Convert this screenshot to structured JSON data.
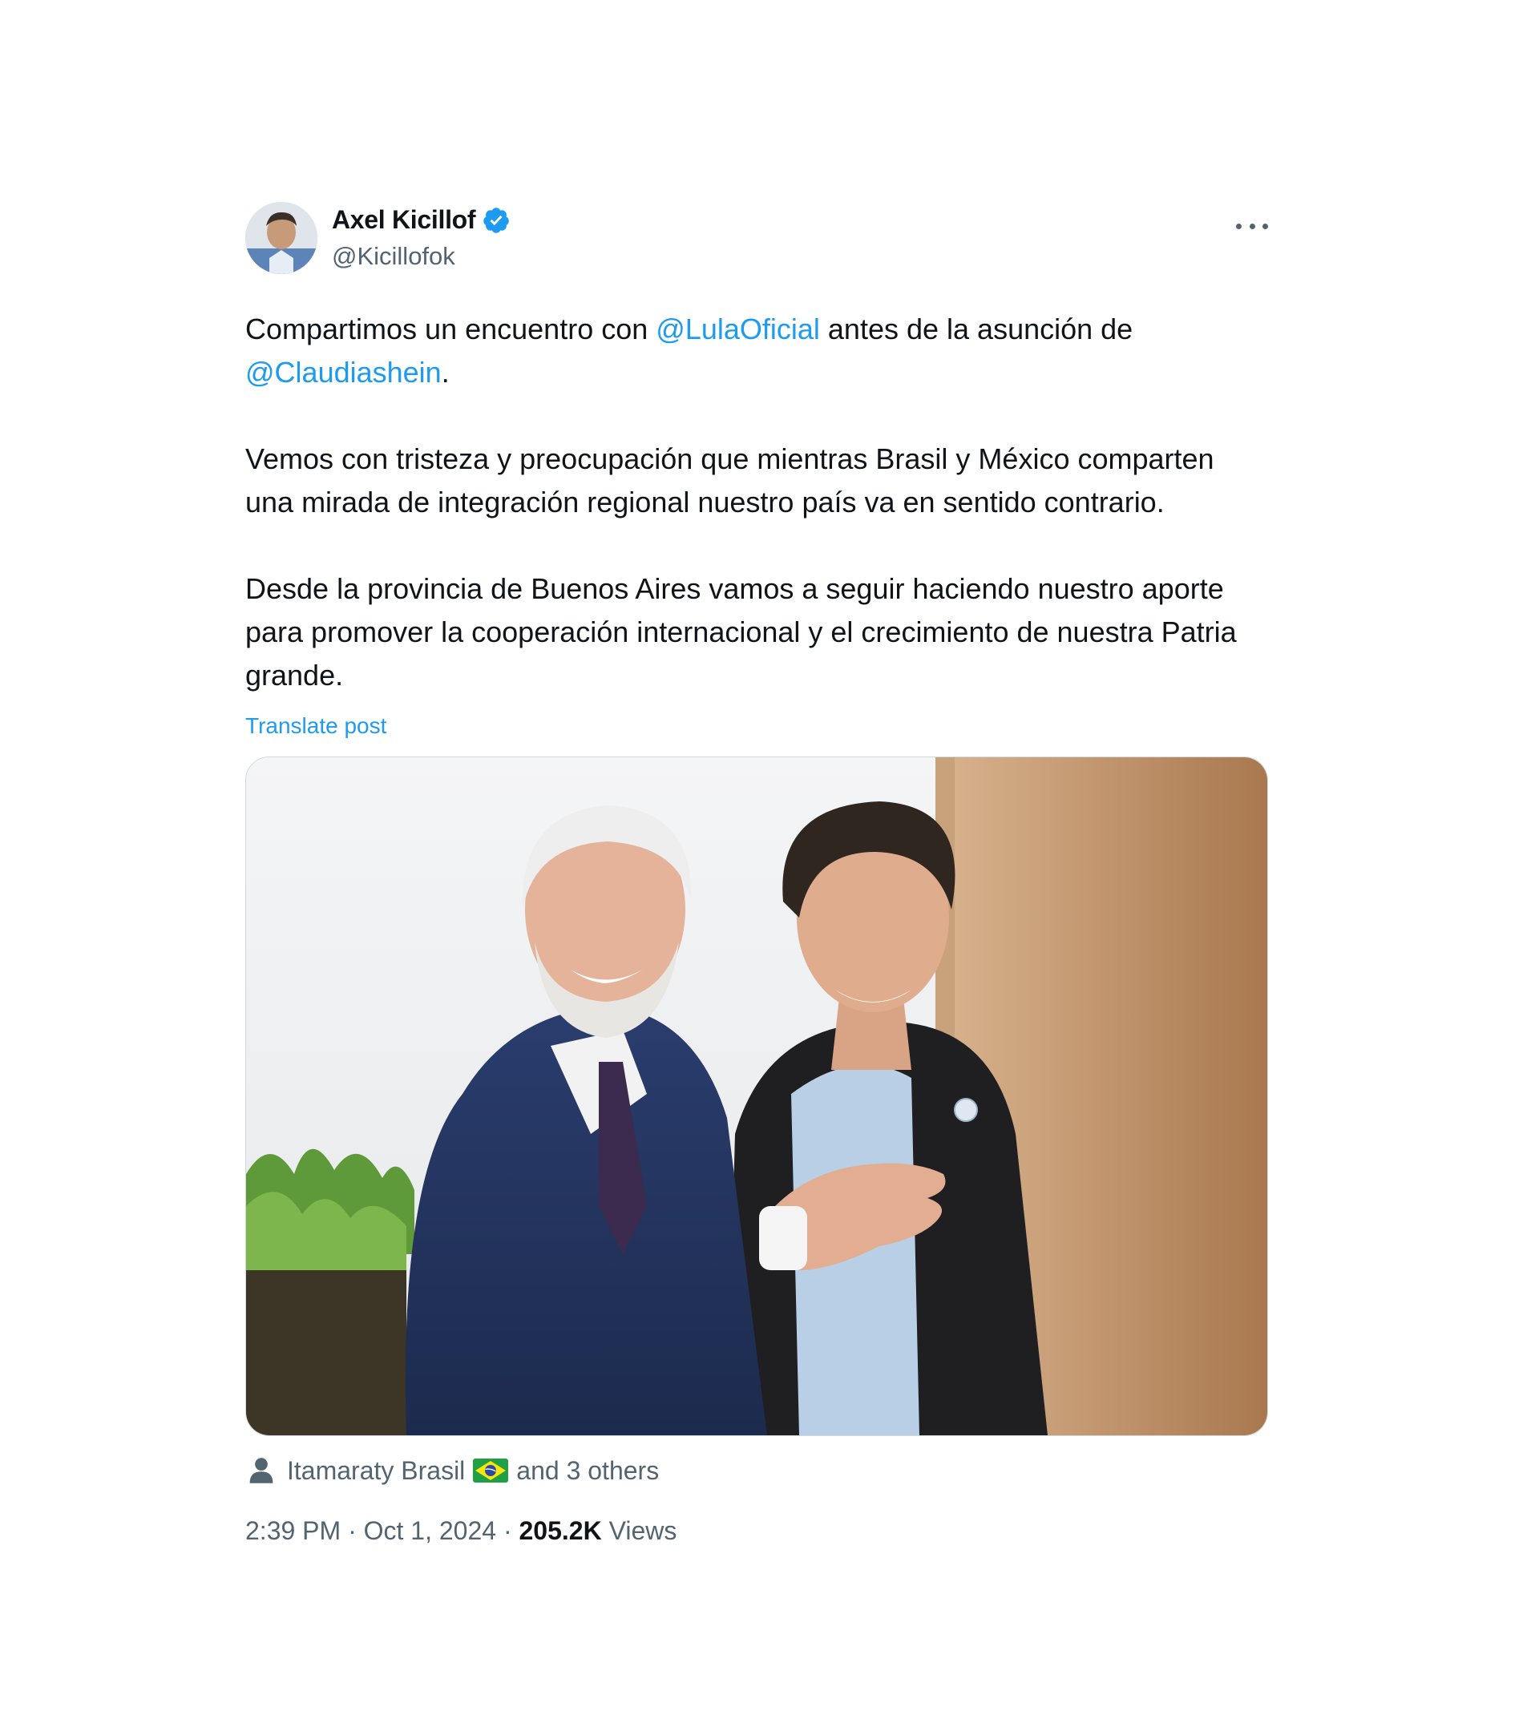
{
  "author": {
    "name": "Axel Kicillof",
    "handle": "@Kicillofok",
    "verified_color": "#1d9bf0"
  },
  "post": {
    "p1_before": "Compartimos un encuentro con ",
    "p1_mention1": "@LulaOficial",
    "p1_middle": " antes de la asunción de ",
    "p1_mention2": "@Claudiashein",
    "p1_after": ".",
    "p2": "Vemos con tristeza y preocupación que mientras Brasil y México comparten una mirada de integración regional nuestro país va en sentido contrario.",
    "p3": "Desde la provincia de Buenos Aires vamos a seguir haciendo nuestro aporte para promover la cooperación internacional y el crecimiento de nuestra Patria grande.",
    "translate_label": "Translate post"
  },
  "tagged": {
    "name": "Itamaraty Brasil",
    "others": "and 3 others"
  },
  "meta": {
    "time": "2:39 PM",
    "separator": " · ",
    "date": "Oct 1, 2024",
    "views_count": "205.2K",
    "views_label": " Views"
  },
  "colors": {
    "link": "#1d9bf0",
    "secondary_text": "#536471",
    "primary_text": "#0f1419"
  }
}
